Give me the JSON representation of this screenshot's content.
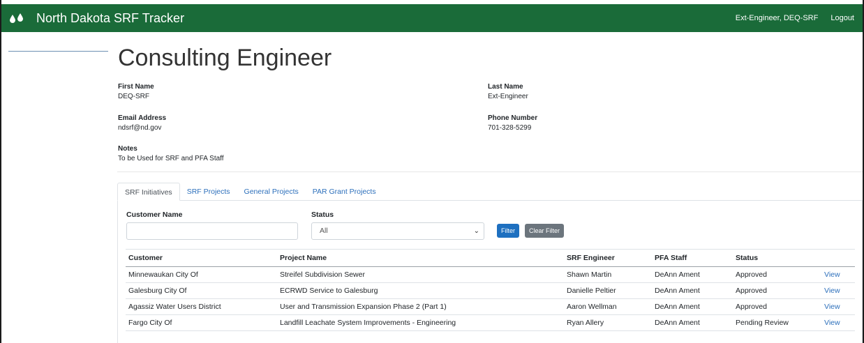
{
  "app": {
    "title": "North Dakota SRF Tracker",
    "user": "Ext-Engineer, DEQ-SRF",
    "logout": "Logout"
  },
  "page": {
    "title": "Consulting Engineer"
  },
  "profile": {
    "first_name": {
      "label": "First Name",
      "value": "DEQ-SRF"
    },
    "last_name": {
      "label": "Last Name",
      "value": "Ext-Engineer"
    },
    "email": {
      "label": "Email Address",
      "value": "ndsrf@nd.gov"
    },
    "phone": {
      "label": "Phone Number",
      "value": "701-328-5299"
    },
    "notes": {
      "label": "Notes",
      "value": "To be Used for SRF and PFA Staff"
    }
  },
  "tabs": [
    "SRF Initiatives",
    "SRF Projects",
    "General Projects",
    "PAR Grant Projects"
  ],
  "filters": {
    "customer_label": "Customer Name",
    "customer_value": "",
    "status_label": "Status",
    "status_value": "All",
    "filter_button": "Filter",
    "clear_button": "Clear Filter"
  },
  "table": {
    "headers": [
      "Customer",
      "Project Name",
      "SRF Engineer",
      "PFA Staff",
      "Status",
      ""
    ],
    "rows": [
      [
        "Minnewaukan City Of",
        "Streifel Subdivision Sewer",
        "Shawn Martin",
        "DeAnn Ament",
        "Approved",
        "View"
      ],
      [
        "Galesburg City Of",
        "ECRWD Service to Galesburg",
        "Danielle Peltier",
        "DeAnn Ament",
        "Approved",
        "View"
      ],
      [
        "Agassiz Water Users District",
        "User and Transmission Expansion Phase 2 (Part 1)",
        "Aaron Wellman",
        "DeAnn Ament",
        "Approved",
        "View"
      ],
      [
        "Fargo City Of",
        "Landfill Leachate System Improvements - Engineering",
        "Ryan Allery",
        "DeAnn Ament",
        "Pending Review",
        "View"
      ]
    ]
  },
  "colors": {
    "navbar": "#1a6b39",
    "link": "#2c6fbb",
    "primary": "#1e70c0",
    "secondary": "#6c757d"
  },
  "icons": {
    "logo": "water-drops-icon",
    "select": "chevron-down-icon"
  }
}
